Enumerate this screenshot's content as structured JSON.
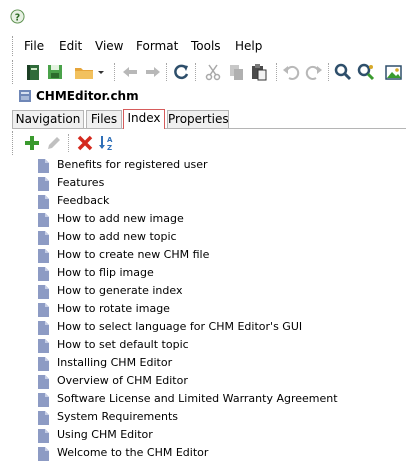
{
  "menu": [
    "File",
    "Edit",
    "View",
    "Format",
    "Tools",
    "Help"
  ],
  "document": {
    "title": "CHMEditor.chm"
  },
  "tabs": [
    {
      "label": "Navigation",
      "active": false
    },
    {
      "label": "Files",
      "active": false
    },
    {
      "label": "Index",
      "active": true
    },
    {
      "label": "Properties",
      "active": false
    }
  ],
  "toolbar_icons": [
    "book-icon",
    "save-icon",
    "open-folder-icon",
    "back-arrow-icon",
    "forward-arrow-icon",
    "refresh-icon",
    "cut-icon",
    "copy-icon",
    "paste-icon",
    "undo-icon",
    "redo-icon",
    "search-icon",
    "find-replace-icon",
    "insert-image-icon"
  ],
  "index_toolbar_icons": [
    "add-icon",
    "edit-icon",
    "delete-icon",
    "sort-az-icon"
  ],
  "index": {
    "items": [
      "Benefits for registered user",
      "Features",
      "Feedback",
      "How to add new image",
      "How to add new topic",
      "How to create new CHM file",
      "How to flip image",
      "How to generate index",
      "How to rotate image",
      "How to select language for CHM Editor's GUI",
      "How to set default topic",
      "Installing CHM Editor",
      "Overview of CHM Editor",
      "Software License and Limited Warranty Agreement",
      "System Requirements",
      "Using CHM Editor",
      "Welcome to the CHM Editor"
    ]
  },
  "colors": {
    "accent_green": "#3a9a2e",
    "delete_red": "#d42a1f",
    "active_tab_border": "#d65b5b",
    "doc_icon": "#8d9bc4"
  }
}
